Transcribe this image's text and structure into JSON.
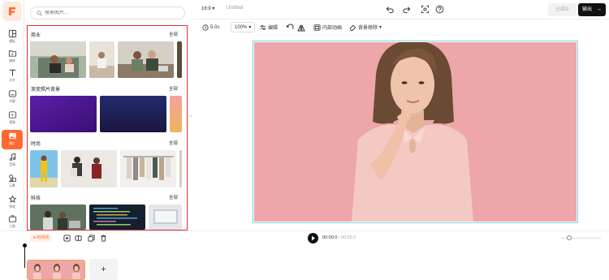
{
  "colors": {
    "accent": "#ff6a30",
    "highlight_border": "#e0312e",
    "canvas_bg": "#eda6aa",
    "export_bg": "#111111"
  },
  "rail": {
    "items": [
      {
        "label": "模板",
        "icon": "template-icon"
      },
      {
        "label": "媒体",
        "icon": "media-icon"
      },
      {
        "label": "文字",
        "icon": "text-icon"
      },
      {
        "label": "字幕",
        "icon": "subtitle-icon"
      },
      {
        "label": "视频",
        "icon": "video-icon"
      },
      {
        "label": "图片",
        "icon": "image-icon",
        "active": true
      },
      {
        "label": "音频",
        "icon": "audio-icon"
      },
      {
        "label": "元素",
        "icon": "elements-icon"
      },
      {
        "label": "特效",
        "icon": "effects-icon"
      },
      {
        "label": "工具",
        "icon": "tools-icon"
      }
    ]
  },
  "panel": {
    "search_placeholder": "搜索图片...",
    "all_label": "全部",
    "sections": [
      {
        "title": "商业"
      },
      {
        "title": "渐变照片背景"
      },
      {
        "title": "时尚"
      },
      {
        "title": "科技"
      }
    ]
  },
  "topbar": {
    "ratio": "16:9",
    "title": "Untitled",
    "saved_label": "已保存",
    "export_label": "输出",
    "export_arrow": "→"
  },
  "toolbar": {
    "duration": "5.0s",
    "zoom": "100%",
    "edit_label": "编辑",
    "animation_label": "内部动画",
    "remove_bg_label": "背景移除"
  },
  "timeline": {
    "tag_label": "时间线",
    "current_time": "00:00.0",
    "total_time": "/ 00:05.0",
    "add_label": "+"
  }
}
